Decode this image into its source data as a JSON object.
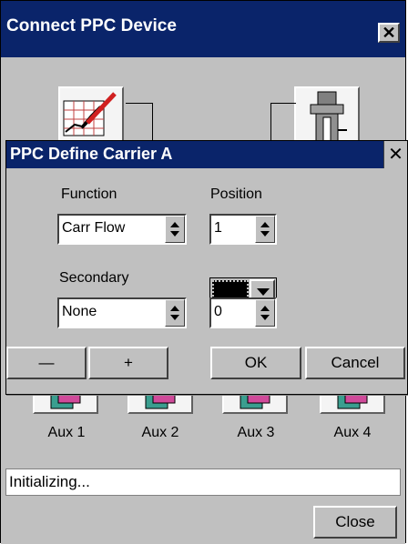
{
  "main_window": {
    "title": "Connect PPC Device",
    "close_glyph": "✕",
    "aux_labels": [
      "Aux 1",
      "Aux 2",
      "Aux 3",
      "Aux 4"
    ],
    "status": "Initializing...",
    "close_button": "Close"
  },
  "dialog": {
    "title": "PPC Define Carrier A",
    "close_glyph": "✕",
    "function_label": "Function",
    "function_value": "Carr Flow",
    "position_label": "Position",
    "position_value": "1",
    "secondary_label": "Secondary",
    "secondary_value": "None",
    "position2_value": "0",
    "minus_button": "—",
    "plus_button": "+",
    "ok_button": "OK",
    "cancel_button": "Cancel"
  },
  "colors": {
    "titlebar": "#0a246a",
    "face": "#c0c0c0"
  }
}
